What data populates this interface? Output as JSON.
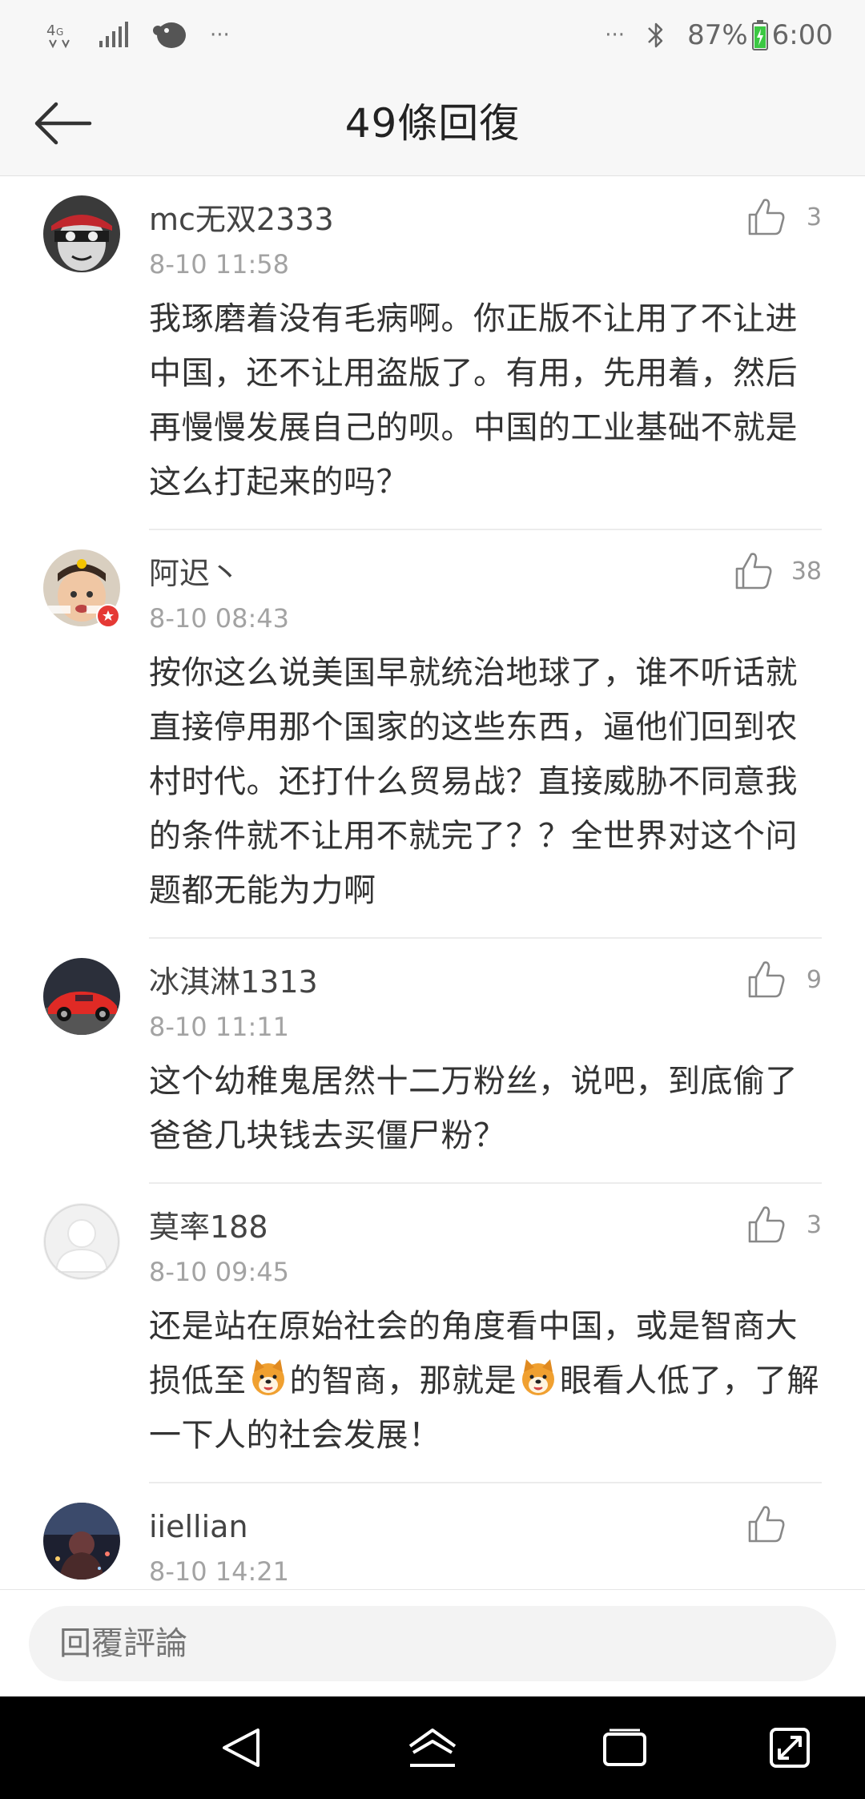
{
  "status_bar": {
    "network": "4G",
    "more_left": "···",
    "more_right": "···",
    "battery_percent": "87%",
    "time": "6:00"
  },
  "header": {
    "title": "49條回復"
  },
  "comments": [
    {
      "username": "mc无双2333",
      "time": "8-10 11:58",
      "likes": "3",
      "text": "我琢磨着没有毛病啊。你正版不让用了不让进中国，还不让用盗版了。有用，先用着，然后再慢慢发展自己的呗。中国的工业基础不就是这么打起来的吗？"
    },
    {
      "username": "阿迟丶",
      "time": "8-10 08:43",
      "likes": "38",
      "text": "按你这么说美国早就统治地球了，谁不听话就直接停用那个国家的这些东西，逼他们回到农村时代。还打什么贸易战？直接威胁不同意我的条件就不让用不就完了？？全世界对这个问题都无能为力啊"
    },
    {
      "username": "冰淇淋1313",
      "time": "8-10 11:11",
      "likes": "9",
      "text": "这个幼稚鬼居然十二万粉丝，说吧，到底偷了爸爸几块钱去买僵尸粉？"
    },
    {
      "username": "莫率188",
      "time": "8-10 09:45",
      "likes": "3",
      "text_parts": [
        "还是站在原始社会的角度看中国，或是智商大损低至",
        "的智商，那就是",
        "眼看人低了，了解一下人的社会发展！"
      ]
    },
    {
      "username": "iiellian",
      "time": "8-10 14:21",
      "likes": "",
      "text": ""
    }
  ],
  "reply_bar": {
    "placeholder": "回覆評論"
  },
  "icons": {
    "back": "arrow-left-icon",
    "like": "thumbs-up-icon",
    "emoji": "dog-face-emoji",
    "nav_back": "triangle-back-icon",
    "nav_home": "home-icon",
    "nav_recents": "recents-icon",
    "nav_fullscreen": "expand-icon"
  },
  "colors": {
    "header_bg": "#f7f7f7",
    "text": "#333333",
    "secondary_text": "#a3a3a3",
    "battery": "#3cc843"
  }
}
